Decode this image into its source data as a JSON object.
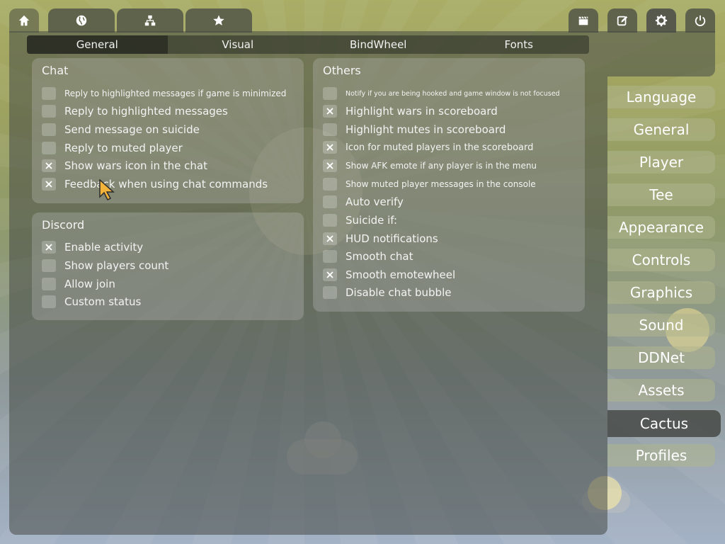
{
  "top_tabs_left": [
    {
      "icon": "home-icon"
    },
    {
      "icon": "globe-icon"
    },
    {
      "icon": "network-icon"
    },
    {
      "icon": "star-icon"
    }
  ],
  "top_tabs_right": [
    {
      "icon": "clapperboard-icon"
    },
    {
      "icon": "edit-icon"
    },
    {
      "icon": "gear-icon"
    },
    {
      "icon": "power-icon"
    }
  ],
  "sub_tabs": [
    "General",
    "Visual",
    "BindWheel",
    "Fonts"
  ],
  "active_sub_tab": "General",
  "chat": {
    "title": "Chat",
    "options": [
      {
        "label": "Reply to highlighted messages if game is minimized",
        "checked": false
      },
      {
        "label": "Reply to highlighted messages",
        "checked": false
      },
      {
        "label": "Send message on suicide",
        "checked": false
      },
      {
        "label": "Reply to muted player",
        "checked": false
      },
      {
        "label": "Show wars icon in the chat",
        "checked": true
      },
      {
        "label": "Feedback when using chat commands",
        "checked": true
      }
    ]
  },
  "discord": {
    "title": "Discord",
    "options": [
      {
        "label": "Enable activity",
        "checked": true
      },
      {
        "label": "Show players count",
        "checked": false
      },
      {
        "label": "Allow join",
        "checked": false
      },
      {
        "label": "Custom status",
        "checked": false
      }
    ]
  },
  "others": {
    "title": "Others",
    "options": [
      {
        "label": "Notify if you are being hooked and game window is not focused",
        "checked": false
      },
      {
        "label": "Highlight wars in scoreboard",
        "checked": true
      },
      {
        "label": "Highlight mutes in scoreboard",
        "checked": false
      },
      {
        "label": "Icon for muted players in the scoreboard",
        "checked": true
      },
      {
        "label": "Show AFK emote if any player is in the menu",
        "checked": true
      },
      {
        "label": "Show muted player messages in the console",
        "checked": false
      },
      {
        "label": "Auto verify",
        "checked": false
      },
      {
        "label": "Suicide if:",
        "checked": false
      },
      {
        "label": "HUD notifications",
        "checked": true
      },
      {
        "label": "Smooth chat",
        "checked": false
      },
      {
        "label": "Smooth emotewheel",
        "checked": true
      },
      {
        "label": "Disable chat bubble",
        "checked": false
      }
    ]
  },
  "side_menu": [
    "Language",
    "General",
    "Player",
    "Tee",
    "Appearance",
    "Controls",
    "Graphics",
    "Sound",
    "DDNet",
    "Assets",
    "Cactus",
    "Profiles"
  ],
  "active_side_item": "Cactus"
}
